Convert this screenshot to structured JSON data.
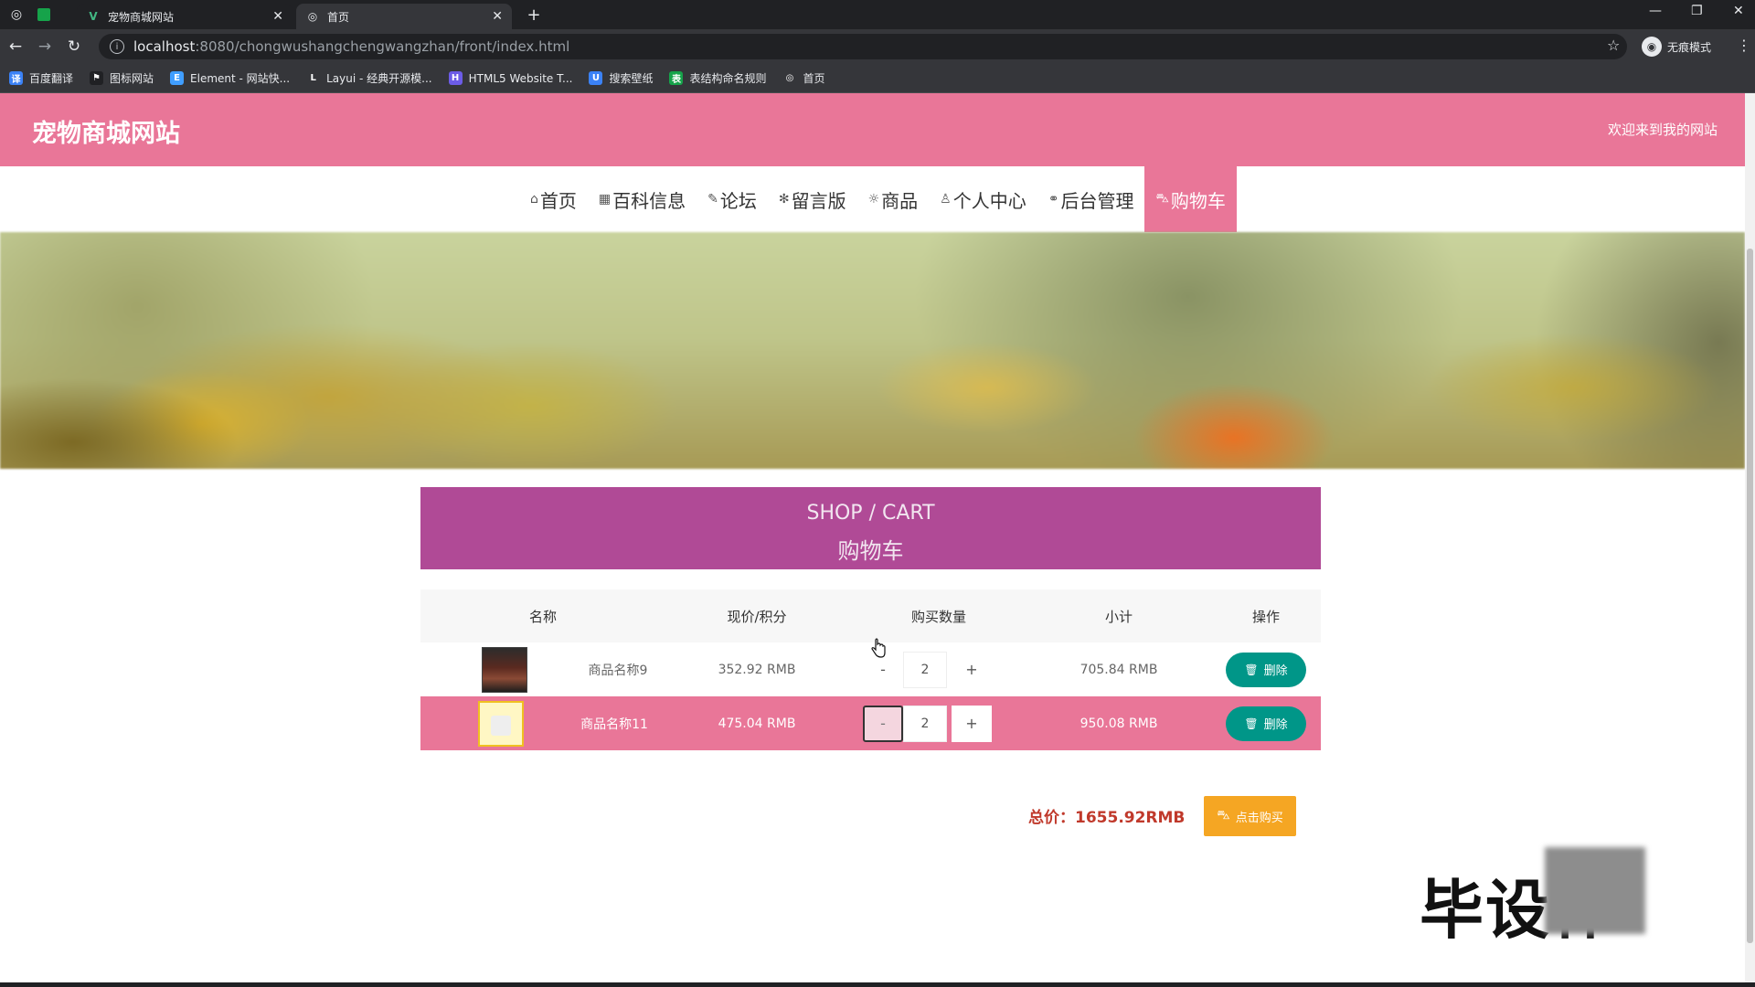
{
  "browser": {
    "tabs": [
      {
        "title": "宠物商城网站",
        "active": false
      },
      {
        "title": "首页",
        "active": true
      }
    ],
    "new_tab": "+",
    "address": {
      "host": "localhost",
      "path": ":8080/chongwushangchengwangzhan/front/index.html"
    },
    "profile_label": "无痕模式",
    "bookmarks": [
      {
        "label": "百度翻译",
        "color": "#3b82f6",
        "glyph": "译"
      },
      {
        "label": "图标网站",
        "color": "#202124",
        "glyph": "⚑"
      },
      {
        "label": "Element - 网站快...",
        "color": "#409eff",
        "glyph": "E"
      },
      {
        "label": "Layui - 经典开源模...",
        "color": "#35363a",
        "glyph": "L"
      },
      {
        "label": "HTML5 Website T...",
        "color": "#6c5ce7",
        "glyph": "H"
      },
      {
        "label": "搜索壁纸",
        "color": "#3b82f6",
        "glyph": "U"
      },
      {
        "label": "表结构命名规则",
        "color": "#16a34a",
        "glyph": "表"
      },
      {
        "label": "首页",
        "color": "#35363a",
        "glyph": "◎"
      }
    ]
  },
  "site": {
    "title": "宠物商城网站",
    "welcome": "欢迎来到我的网站",
    "accent_color": "#e97698",
    "nav": [
      {
        "icon": "⌂",
        "label": "首页",
        "name": "home"
      },
      {
        "icon": "▦",
        "label": "百科信息",
        "name": "encyclopedia"
      },
      {
        "icon": "✎",
        "label": "论坛",
        "name": "forum"
      },
      {
        "icon": "✻",
        "label": "留言版",
        "name": "message-board"
      },
      {
        "icon": "☼",
        "label": "商品",
        "name": "products"
      },
      {
        "icon": "♙",
        "label": "个人中心",
        "name": "personal-center"
      },
      {
        "icon": "⚭",
        "label": "后台管理",
        "name": "admin"
      },
      {
        "icon": "⛍",
        "label": "购物车",
        "name": "cart",
        "active": true
      }
    ],
    "carousel": {
      "slide_count": 3,
      "active_index": 2
    }
  },
  "cart": {
    "heading_en": "SHOP / CART",
    "heading_cn": "购物车",
    "heading_color": "#b04a96",
    "columns": [
      "名称",
      "现价/积分",
      "购买数量",
      "小计",
      "操作"
    ],
    "rows": [
      {
        "name": "商品名称9",
        "price": "352.92 RMB",
        "qty": "2",
        "subtotal": "705.84 RMB",
        "highlighted": false
      },
      {
        "name": "商品名称11",
        "price": "475.04 RMB",
        "qty": "2",
        "subtotal": "950.08 RMB",
        "highlighted": true
      }
    ],
    "minus_label": "-",
    "plus_label": "+",
    "delete_label": "删除",
    "delete_color": "#009688",
    "total_label": "总价：",
    "total_value": "1655.92RMB",
    "buy_label": "点击购买",
    "buy_color": "#f5a623"
  },
  "watermark": "毕设作"
}
